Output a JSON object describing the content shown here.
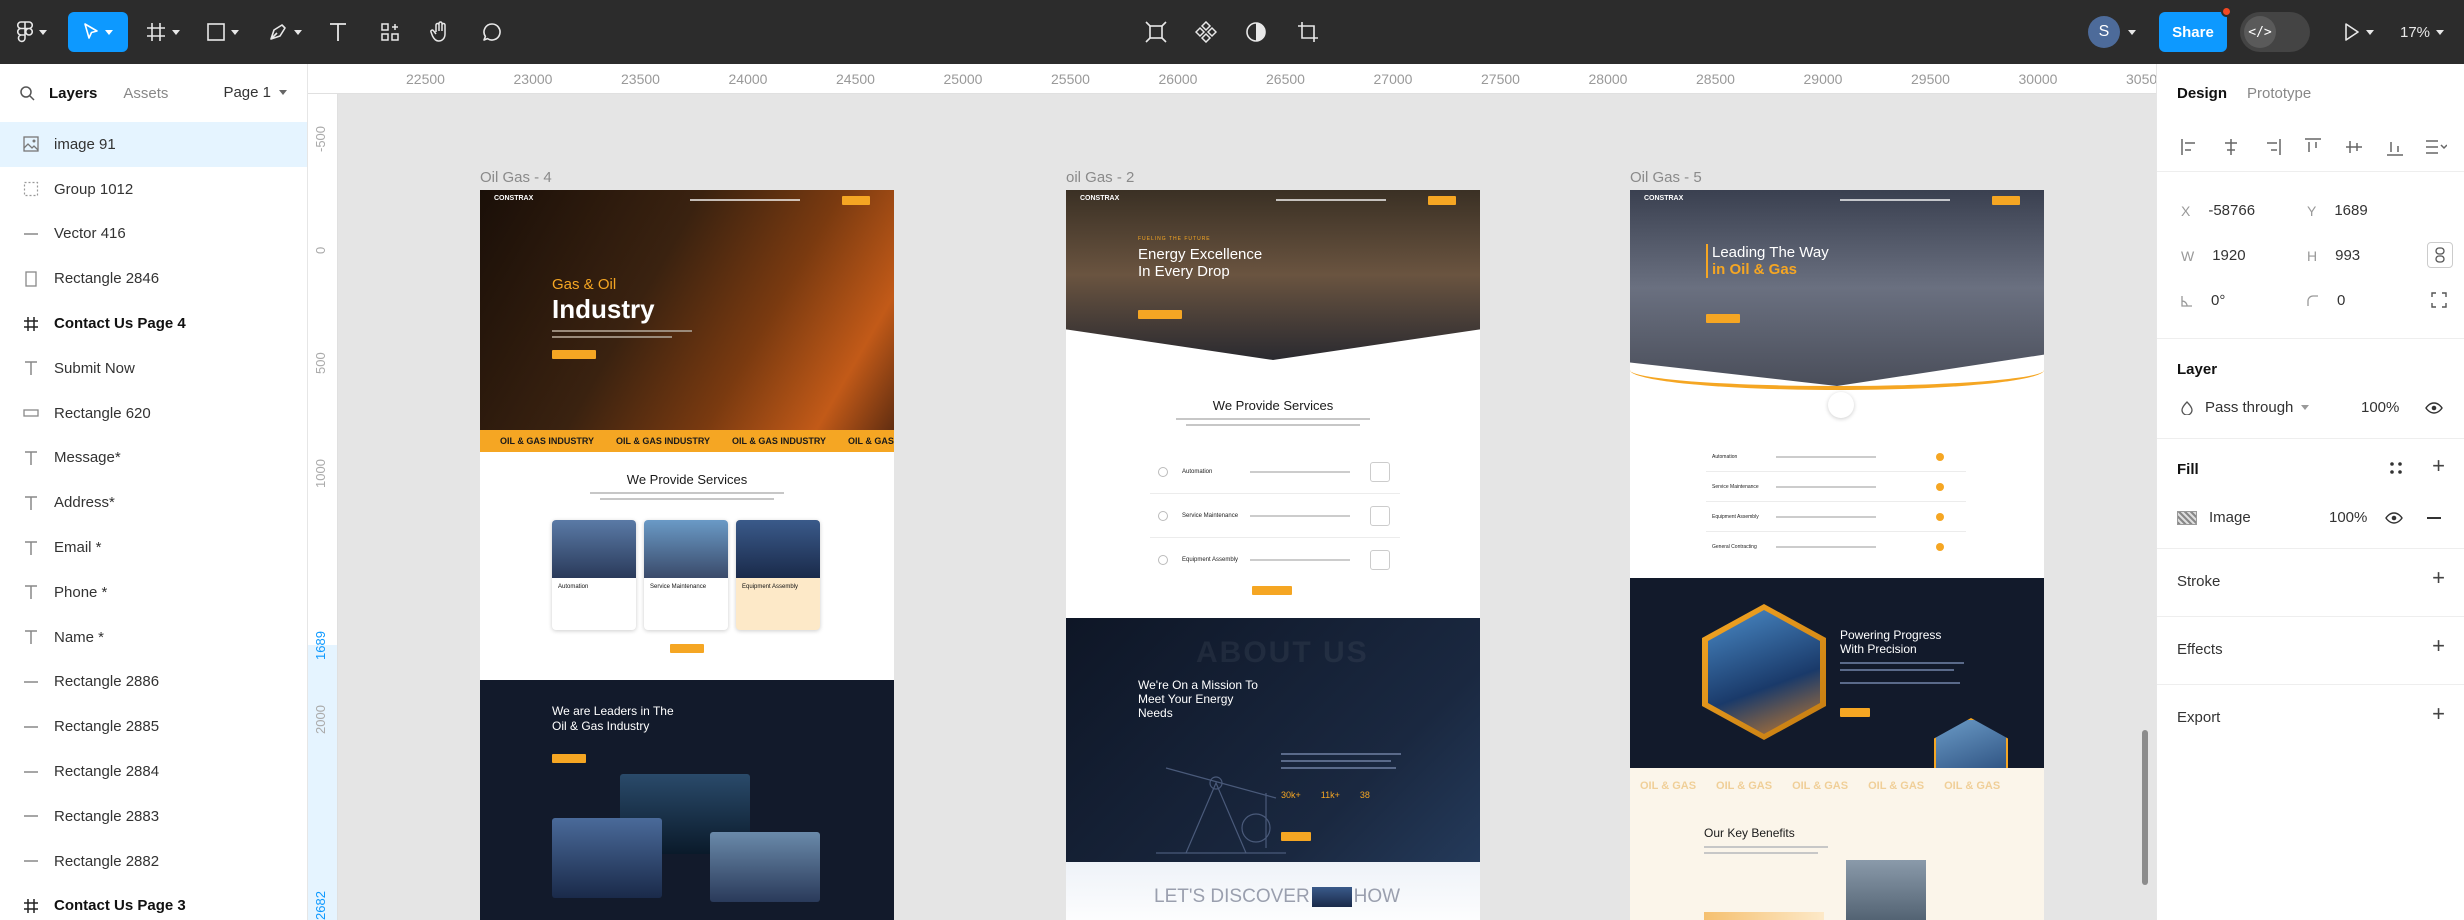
{
  "toolbar": {
    "zoom": "17%",
    "share_label": "Share",
    "avatar_initial": "S"
  },
  "left_panel": {
    "tabs": {
      "layers": "Layers",
      "assets": "Assets"
    },
    "page_selector": "Page 1",
    "layers": [
      {
        "name": "image 91",
        "icon": "image-icon",
        "selected": true,
        "bold": false
      },
      {
        "name": "Group 1012",
        "icon": "group-icon",
        "selected": false,
        "bold": false
      },
      {
        "name": "Vector 416",
        "icon": "line-icon",
        "selected": false,
        "bold": false
      },
      {
        "name": "Rectangle 2846",
        "icon": "rectangle-tall-icon",
        "selected": false,
        "bold": false
      },
      {
        "name": "Contact Us Page 4",
        "icon": "frame-icon",
        "selected": false,
        "bold": true
      },
      {
        "name": "Submit Now",
        "icon": "text-icon",
        "selected": false,
        "bold": false
      },
      {
        "name": "Rectangle 620",
        "icon": "rectangle-wide-icon",
        "selected": false,
        "bold": false
      },
      {
        "name": "Message*",
        "icon": "text-icon",
        "selected": false,
        "bold": false
      },
      {
        "name": "Address*",
        "icon": "text-icon",
        "selected": false,
        "bold": false
      },
      {
        "name": "Email *",
        "icon": "text-icon",
        "selected": false,
        "bold": false
      },
      {
        "name": "Phone *",
        "icon": "text-icon",
        "selected": false,
        "bold": false
      },
      {
        "name": "Name *",
        "icon": "text-icon",
        "selected": false,
        "bold": false
      },
      {
        "name": "Rectangle 2886",
        "icon": "line-icon",
        "selected": false,
        "bold": false
      },
      {
        "name": "Rectangle 2885",
        "icon": "line-icon",
        "selected": false,
        "bold": false
      },
      {
        "name": "Rectangle 2884",
        "icon": "line-icon",
        "selected": false,
        "bold": false
      },
      {
        "name": "Rectangle 2883",
        "icon": "line-icon",
        "selected": false,
        "bold": false
      },
      {
        "name": "Rectangle 2882",
        "icon": "line-icon",
        "selected": false,
        "bold": false
      },
      {
        "name": "Contact Us Page 3",
        "icon": "frame-icon",
        "selected": false,
        "bold": true
      }
    ]
  },
  "ruler": {
    "top": [
      "22500",
      "23000",
      "23500",
      "24000",
      "24500",
      "25000",
      "25500",
      "26000",
      "26500",
      "27000",
      "27500",
      "28000",
      "28500",
      "29000",
      "29500",
      "30000",
      "3050"
    ],
    "left": [
      "-500",
      "0",
      "500",
      "1000",
      "1689",
      "2000",
      "2682"
    ]
  },
  "frames": {
    "f1": {
      "title": "Oil Gas - 4",
      "hero_kicker": "Gas & Oil",
      "hero_title": "Industry",
      "ticker": "OIL & GAS INDUSTRY",
      "services_title": "We Provide Services",
      "cards": [
        "Automation",
        "Service Maintenance",
        "Equipment Assembly"
      ],
      "leaders_title_1": "We are Leaders in The",
      "leaders_title_2": "Oil & Gas Industry",
      "brand": "CONSTRAX"
    },
    "f2": {
      "title": "oil Gas - 2",
      "hero_kicker": "FUELING THE FUTURE",
      "hero_title_1": "Energy Excellence",
      "hero_title_2": "In Every Drop",
      "services_title": "We Provide Services",
      "services": [
        "Automation",
        "Service Maintenance",
        "Equipment Assembly"
      ],
      "mission_1": "We're On a Mission To",
      "mission_2": "Meet Your Energy",
      "mission_3": "Needs",
      "about_ghost": "ABOUT US",
      "stats": [
        "30k+",
        "11k+",
        "38"
      ],
      "discover": "LET'S DISCOVER",
      "how": "HOW",
      "brand": "CONSTRAX"
    },
    "f3": {
      "title": "Oil Gas - 5",
      "hero_title_1": "Leading The Way",
      "hero_title_2": "in Oil & Gas",
      "services": [
        "Automation",
        "Service Maintenance",
        "Equipment Assembly",
        "General Contracting"
      ],
      "powering_1": "Powering Progress",
      "powering_2": "With Precision",
      "ticker": "OIL & GAS",
      "benefits": "Our Key Benefits",
      "brand": "CONSTRAX"
    }
  },
  "right_panel": {
    "tabs": {
      "design": "Design",
      "prototype": "Prototype"
    },
    "x_label": "X",
    "x_value": "-58766",
    "y_label": "Y",
    "y_value": "1689",
    "w_label": "W",
    "w_value": "1920",
    "h_label": "H",
    "h_value": "993",
    "rotation_value": "0°",
    "radius_value": "0",
    "layer_title": "Layer",
    "blend_mode": "Pass through",
    "layer_opacity": "100%",
    "fill_title": "Fill",
    "fill_type": "Image",
    "fill_opacity": "100%",
    "stroke_title": "Stroke",
    "effects_title": "Effects",
    "export_title": "Export"
  },
  "colors": {
    "accent": "#0d99ff",
    "toolbar_bg": "#2c2c2c",
    "orange": "#f5a623",
    "navy": "#121a2b"
  }
}
